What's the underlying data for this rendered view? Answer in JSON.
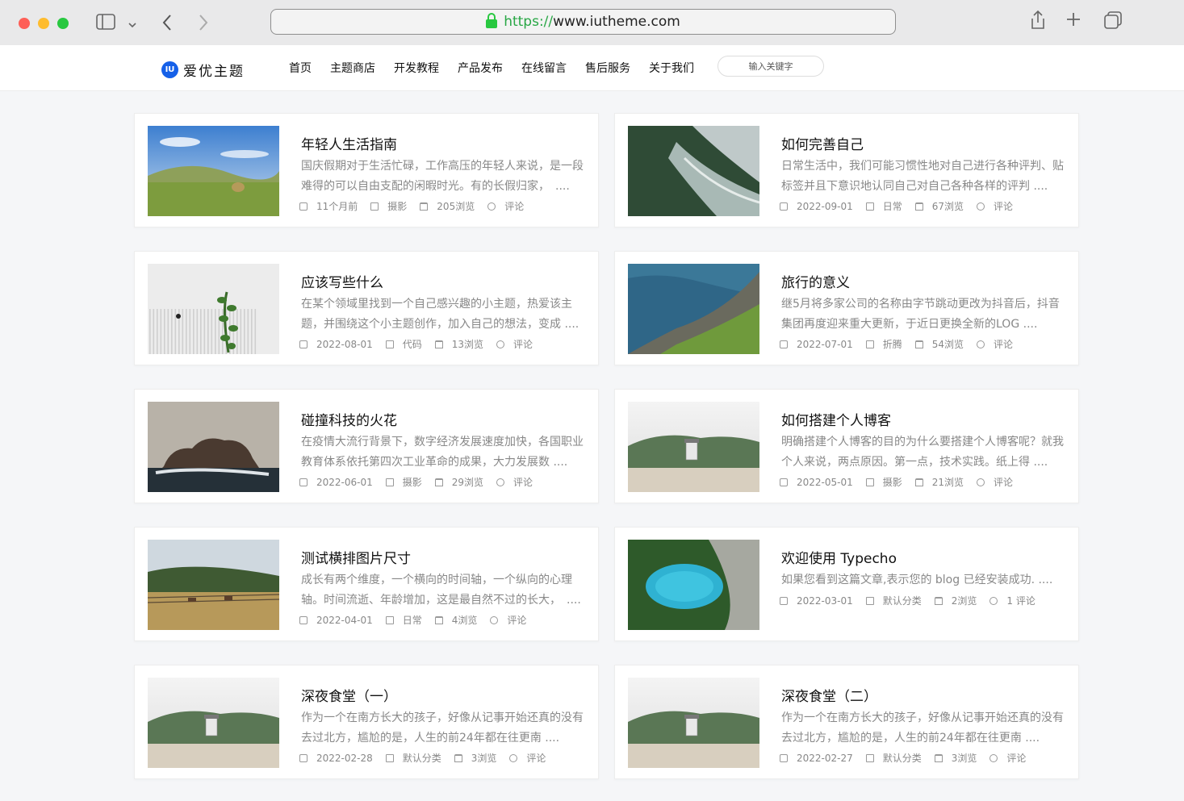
{
  "browser": {
    "url_scheme": "https://",
    "url_host": "www.iutheme.com"
  },
  "site": {
    "logo_badge": "IU",
    "logo_text": "爱优主题",
    "nav": [
      "首页",
      "主题商店",
      "开发教程",
      "产品发布",
      "在线留言",
      "售后服务",
      "关于我们"
    ],
    "search_placeholder": "输入关键字"
  },
  "posts": [
    {
      "title": "年轻人生活指南",
      "excerpt": "国庆假期对于生活忙碌，工作高压的年轻人来说，是一段难得的可以自由支配的闲暇时光。有的长假归家，　....",
      "date": "11个月前",
      "category": "摄影",
      "views": "205浏览",
      "comments": "评论",
      "thumb": "meadow"
    },
    {
      "title": "如何完善自己",
      "excerpt": "日常生活中，我们可能习惯性地对自己进行各种评判、贴标签并且下意识地认同自己对自己各种各样的评判 ....",
      "date": "2022-09-01",
      "category": "日常",
      "views": "67浏览",
      "comments": "评论",
      "thumb": "coast"
    },
    {
      "title": "应该写些什么",
      "excerpt": "在某个领域里找到一个自己感兴趣的小主题，热爱该主题，并围绕这个小主题创作，加入自己的想法，变成 ....",
      "date": "2022-08-01",
      "category": "代码",
      "views": "13浏览",
      "comments": "评论",
      "thumb": "plant"
    },
    {
      "title": "旅行的意义",
      "excerpt": "继5月将多家公司的名称由字节跳动更改为抖音后，抖音集团再度迎来重大更新，于近日更换全新的LOG ....",
      "date": "2022-07-01",
      "category": "折腾",
      "views": "54浏览",
      "comments": "评论",
      "thumb": "cliffs"
    },
    {
      "title": "碰撞科技的火花",
      "excerpt": "在疫情大流行背景下，数字经济发展速度加快，各国职业教育体系依托第四次工业革命的成果，大力发展数 ....",
      "date": "2022-06-01",
      "category": "摄影",
      "views": "29浏览",
      "comments": "评论",
      "thumb": "rock"
    },
    {
      "title": "如何搭建个人博客",
      "excerpt": "明确搭建个人博客的目的为什么要搭建个人博客呢？就我个人来说，两点原因。第一点，技术实践。纸上得 ....",
      "date": "2022-05-01",
      "category": "摄影",
      "views": "21浏览",
      "comments": "评论",
      "thumb": "beach"
    },
    {
      "title": "测试横排图片尺寸",
      "excerpt": "成长有两个维度，一个横向的时间轴，一个纵向的心理轴。时间流逝、年龄增加，这是最自然不过的长大，　....",
      "date": "2022-04-01",
      "category": "日常",
      "views": "4浏览",
      "comments": "评论",
      "thumb": "horses"
    },
    {
      "title": "欢迎使用 Typecho",
      "excerpt": "如果您看到这篇文章,表示您的 blog 已经安装成功. ....",
      "date": "2022-03-01",
      "category": "默认分类",
      "views": "2浏览",
      "comments": "1 评论",
      "thumb": "lake",
      "short": true
    },
    {
      "title": "深夜食堂（一）",
      "excerpt": "作为一个在南方长大的孩子，好像从记事开始还真的没有去过北方，尴尬的是，人生的前24年都在往更南 ....",
      "date": "2022-02-28",
      "category": "默认分类",
      "views": "3浏览",
      "comments": "评论",
      "thumb": "beach"
    },
    {
      "title": "深夜食堂（二）",
      "excerpt": "作为一个在南方长大的孩子，好像从记事开始还真的没有去过北方，尴尬的是，人生的前24年都在往更南 ....",
      "date": "2022-02-27",
      "category": "默认分类",
      "views": "3浏览",
      "comments": "评论",
      "thumb": "beach"
    }
  ]
}
